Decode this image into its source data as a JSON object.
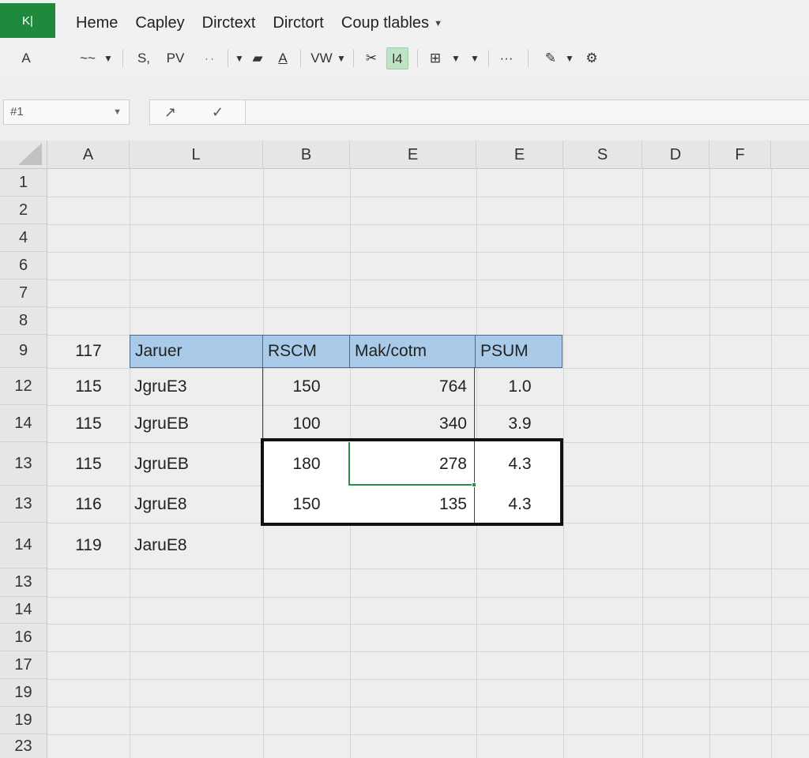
{
  "app": {
    "badge": "K|"
  },
  "menu": [
    {
      "label": "Heme"
    },
    {
      "label": "Capley"
    },
    {
      "label": "Dirctext"
    },
    {
      "label": "Dirctort"
    },
    {
      "label": "Coup tlables",
      "has_dropdown": true
    }
  ],
  "toolbar": {
    "font_a": "A",
    "squiggle": "~~",
    "s_label": "S,",
    "pv_label": "PV",
    "dots_small": "· ·",
    "font_color_label": "A",
    "vw_label": "VW",
    "l4_label": "l4",
    "more": "···",
    "highlight_color": "#bfe3c6"
  },
  "formula_bar": {
    "name_box": "#1",
    "cancel_icon": "arrow-icon",
    "enter_icon": "check-icon",
    "formula": ""
  },
  "grid": {
    "columns": [
      "A",
      "L",
      "B",
      "E",
      "E",
      "S",
      "D",
      "F"
    ],
    "rows": [
      "1",
      "2",
      "4",
      "6",
      "7",
      "8",
      "9",
      "12",
      "14",
      "13",
      "13",
      "14",
      "13",
      "14",
      "16",
      "17",
      "19",
      "19",
      "23"
    ],
    "header_row": {
      "a": "117",
      "l": "Jaruer",
      "b": "RSCM",
      "e": "Mak/cotm",
      "e2": "PSUM"
    },
    "data_rows": [
      {
        "a": "115",
        "l": "JgruE3",
        "b": "150",
        "e": "764",
        "e2": "1.0"
      },
      {
        "a": "115",
        "l": "JgruEB",
        "b": "100",
        "e": "340",
        "e2": "3.9"
      },
      {
        "a": "115",
        "l": "JgruEB",
        "b": "180",
        "e": "278",
        "e2": "4.3"
      },
      {
        "a": "116",
        "l": "JgruE8",
        "b": "150",
        "e": "135",
        "e2": "4.3"
      },
      {
        "a": "119",
        "l": "JaruE8",
        "b": "",
        "e": "",
        "e2": ""
      }
    ],
    "header_fill": "#a9cbe9",
    "active_border_color": "#2e8b4a"
  }
}
